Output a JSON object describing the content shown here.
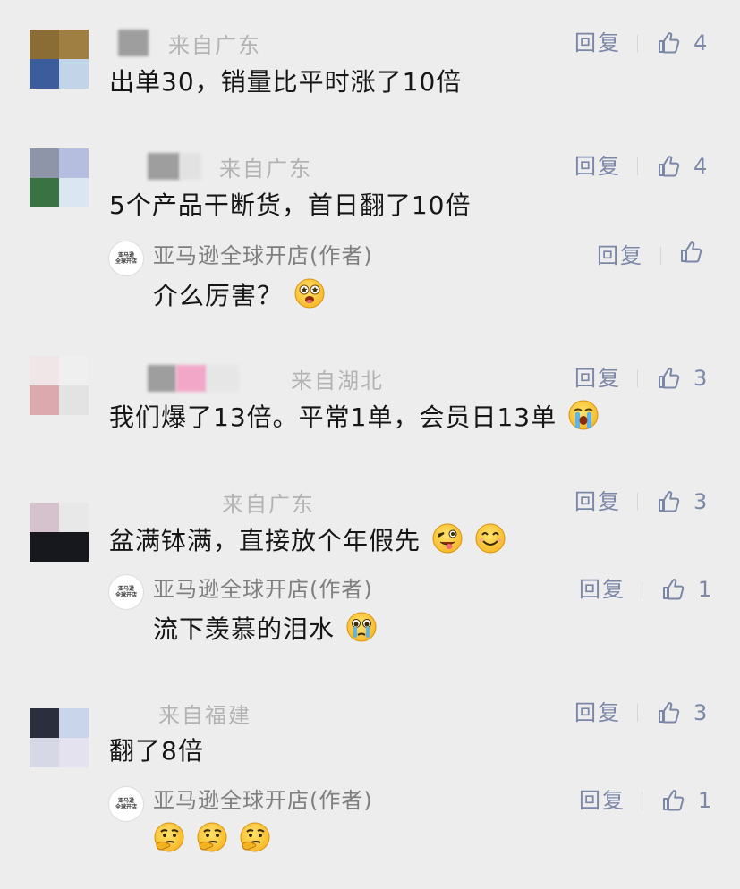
{
  "comments": [
    {
      "region": "来自广东",
      "text": "出单30，销量比平时涨了10倍",
      "reply_label": "回复",
      "likes": "4",
      "avatar_colors": [
        "#8a6c35",
        "#a07f42",
        "#3c5c9c",
        "#c2d5e8"
      ]
    },
    {
      "region": "来自广东",
      "text": "5个产品干断货，首日翻了10倍",
      "reply_label": "回复",
      "likes": "4",
      "avatar_colors": [
        "#8f95a8",
        "#b5bedf",
        "#3a7244",
        "#dbe6f3"
      ],
      "author_reply": {
        "name": "亚马逊全球开店(作者)",
        "logo_line1": "亚马逊",
        "logo_line2": "全球开店",
        "text": "介么厉害？",
        "reply_label": "回复",
        "likes": ""
      }
    },
    {
      "region": "来自湖北",
      "text": "我们爆了13倍。平常1单，会员日13单",
      "reply_label": "回复",
      "likes": "3",
      "avatar_colors": [
        "#f0e6e8",
        "#efefef",
        "#dcaaae",
        "#e3e3e3"
      ]
    },
    {
      "region": "来自广东",
      "text": "盆满钵满，直接放个年假先",
      "reply_label": "回复",
      "likes": "3",
      "avatar_colors": [
        "#d6c2cc",
        "#e8e8e8",
        "#17181d",
        "#17181d"
      ],
      "author_reply": {
        "name": "亚马逊全球开店(作者)",
        "logo_line1": "亚马逊",
        "logo_line2": "全球开店",
        "text": "流下羡慕的泪水",
        "reply_label": "回复",
        "likes": "1"
      }
    },
    {
      "region": "来自福建",
      "text": "翻了8倍",
      "reply_label": "回复",
      "likes": "3",
      "avatar_colors": [
        "#2b2f3d",
        "#c8d5ea",
        "#d6d8e6",
        "#e4e2ee"
      ],
      "author_reply": {
        "name": "亚马逊全球开店(作者)",
        "logo_line1": "亚马逊",
        "logo_line2": "全球开店",
        "text": "",
        "reply_label": "回复",
        "likes": "1"
      }
    }
  ],
  "colors": {
    "background": "#ededed",
    "text": "#161616",
    "meta": "#b3b3b3",
    "action": "#7a87a6"
  },
  "icons": {
    "like": "thumbs-up-icon",
    "emoji_star_eyes": "star-eyes-emoji-icon",
    "emoji_crying": "loudly-crying-emoji-icon",
    "emoji_wink_tongue": "winking-tongue-emoji-icon",
    "emoji_smile": "smiling-emoji-icon",
    "emoji_teary": "teary-emoji-icon",
    "emoji_thinking": "thinking-emoji-icon"
  }
}
